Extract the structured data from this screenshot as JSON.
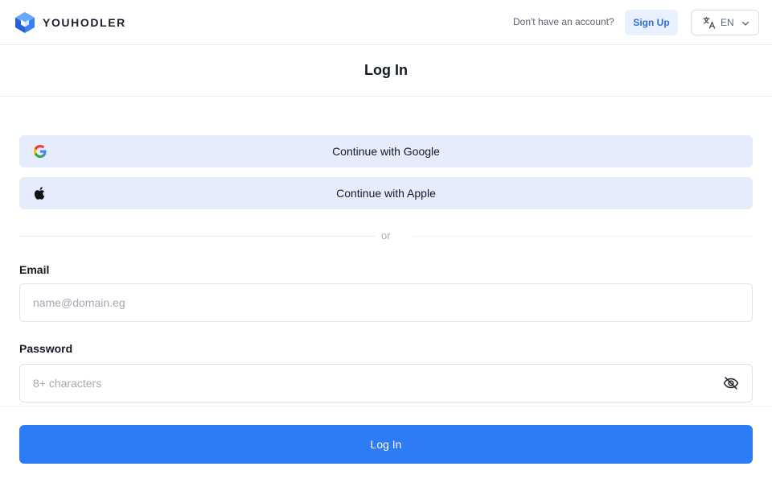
{
  "header": {
    "brand": "YOUHODLER",
    "no_account_text": "Don't have an account?",
    "signup_label": "Sign Up",
    "language": "EN"
  },
  "page": {
    "title": "Log In"
  },
  "social": {
    "google_label": "Continue with Google",
    "apple_label": "Continue with Apple"
  },
  "divider_text": "or",
  "form": {
    "email_label": "Email",
    "email_placeholder": "name@domain.eg",
    "email_value": "",
    "password_label": "Password",
    "password_placeholder": "8+ characters",
    "password_value": ""
  },
  "submit_label": "Log In",
  "colors": {
    "primary": "#2e7bf6",
    "social_bg": "#e5edfd",
    "signup_bg": "#e9f1ff",
    "signup_text": "#2f6fd9"
  }
}
